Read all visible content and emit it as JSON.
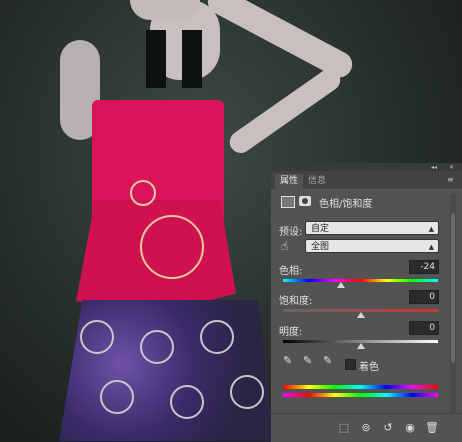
{
  "panel": {
    "tabs": [
      {
        "label": "属性",
        "active": true
      },
      {
        "label": "信息",
        "active": false
      }
    ],
    "panel_title": "色相/饱和度",
    "preset": {
      "label": "预设:",
      "value": "自定"
    },
    "channel": {
      "value": "全图"
    },
    "hue": {
      "label": "色相:",
      "value": "-24"
    },
    "saturation": {
      "label": "饱和度:",
      "value": "0"
    },
    "lightness": {
      "label": "明度:",
      "value": "0"
    },
    "colorize": {
      "label": "着色",
      "checked": false
    }
  },
  "colors": {
    "panel_bg": "#535353",
    "dress": "#d9145a",
    "skirt": "#3b2a69"
  }
}
